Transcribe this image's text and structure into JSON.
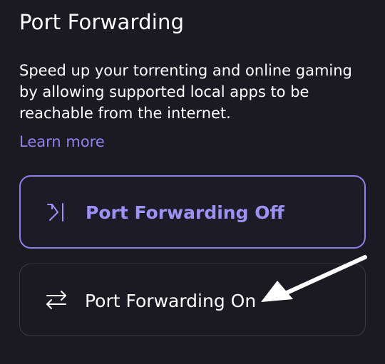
{
  "section": {
    "title": "Port Forwarding",
    "description": "Speed up your torrenting and online gaming by allowing supported local apps to be reachable from the internet.",
    "learn_more": "Learn more"
  },
  "options": [
    {
      "label": "Port Forwarding Off",
      "icon": "forward-to-bar-icon",
      "selected": true
    },
    {
      "label": "Port Forwarding On",
      "icon": "swap-arrows-icon",
      "selected": false
    }
  ],
  "colors": {
    "background": "#1b1a22",
    "accent": "#8f83ec",
    "selected_border": "#8b80e8",
    "unselected_border": "#3b3944",
    "text": "#ffffff",
    "annotation_arrow": "#ffffff"
  }
}
